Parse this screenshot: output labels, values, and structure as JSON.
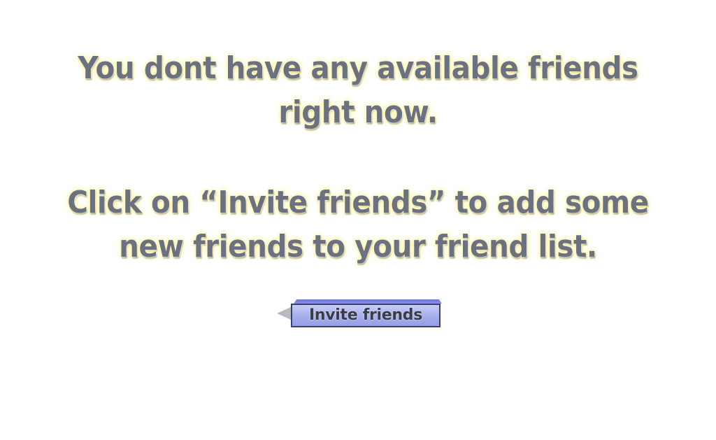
{
  "message": {
    "primary_lines": [
      "You dont have any available friends",
      "right now."
    ],
    "secondary_lines": [
      "Click on “Invite friends” to add some",
      "new friends to your friend list."
    ]
  },
  "invite_button": {
    "label": "Invite friends"
  },
  "colors": {
    "text": "#6b7181",
    "text_glow": "#fff6b0",
    "button_fill": "#aab1ee",
    "button_border": "#3b3f6e"
  }
}
